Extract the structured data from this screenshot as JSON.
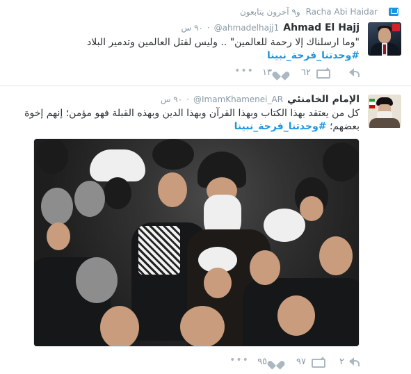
{
  "colors": {
    "accent": "#1b95e0",
    "text": "#292f33",
    "muted": "#8899a6",
    "icon": "#aab8c2",
    "border": "#e1e8ed"
  },
  "tweets": [
    {
      "context": {
        "icon": "retweet-context-icon",
        "users": "Racha Abi Haidar",
        "suffix": "و٩ آخرون يتابعون"
      },
      "display_name": "Ahmad El Hajj",
      "handle": "@ahmadelhajj1",
      "time": "٩٠ س",
      "body_lines": [
        "\"وما ارسلناك إلا رحمة للعالمين\" .. وليس لقتل العالمين وتدمير البلاد"
      ],
      "hashtag": "#وحدتنا_فرحة_نبينا",
      "actions": {
        "reply_count": "",
        "retweet_count": "٦٢",
        "like_count": "١٣",
        "more": "•••"
      }
    },
    {
      "display_name": "الإمام الخامنئي",
      "handle": "@ImamKhamenei_AR",
      "time": "٩٠ س",
      "body_lines": [
        "كل من يعتقد بهذا الكتاب وبهذا القرآن وبهذا الدين وبهذه القبلة فهو مؤمن؛ إنهم إخوة",
        "بعضهم؛"
      ],
      "hashtag": "#وحدتنا_فرحة_نبينا",
      "actions": {
        "reply_count": "٢",
        "retweet_count": "٩٧",
        "like_count": "٩٥",
        "more": "•••"
      }
    }
  ]
}
